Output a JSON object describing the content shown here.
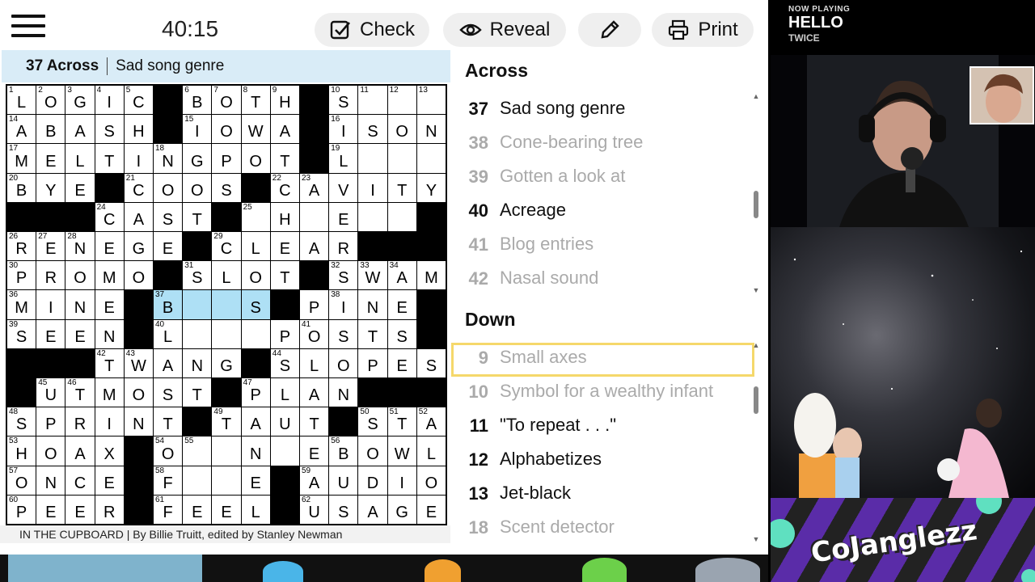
{
  "toolbar": {
    "timer": "40:15",
    "check_label": "Check",
    "reveal_label": "Reveal",
    "print_label": "Print"
  },
  "current_clue": {
    "ref": "37 Across",
    "text": "Sad song genre"
  },
  "grid": {
    "rows": [
      "LOGIC#BOTH#S???",
      "ABASH#IOWA#ISON",
      "MELTINGPOT#L???",
      "BYE#COOS#CAVITY",
      "###CAST#?H?E??#",
      "RENEGE#CLEAR###",
      "PROMO#SLOT#SWAM",
      "MINE#B??S#PINE",
      "SEEN#L???POSTS",
      "###TWANG#SLOPES",
      "#UTMOST#PLAN###",
      "SPRINT#TAUT#STA",
      "HOAX#O??N?EBOWL",
      "ONCE#F??E#AUDIO",
      "PEER#FEEL#USAGE"
    ],
    "numbers": {
      "0,0": "1",
      "0,1": "2",
      "0,2": "3",
      "0,3": "4",
      "0,4": "5",
      "0,6": "6",
      "0,7": "7",
      "0,8": "8",
      "0,9": "9",
      "0,11": "10",
      "0,12": "11",
      "0,13": "12",
      "0,14": "13",
      "1,0": "14",
      "1,6": "15",
      "1,11": "16",
      "2,0": "17",
      "2,5": "18",
      "2,11": "19",
      "3,0": "20",
      "3,4": "21",
      "3,9": "22",
      "3,10": "23",
      "4,3": "24",
      "4,8": "25",
      "5,0": "26",
      "5,1": "27",
      "5,2": "28",
      "5,7": "29",
      "6,0": "30",
      "6,6": "31",
      "6,11": "32",
      "6,12": "33",
      "6,13": "34",
      "7,0": "36",
      "7,5": "37",
      "7,11": "38",
      "8,0": "39",
      "8,5": "40",
      "8,10": "41",
      "9,3": "42",
      "9,4": "43",
      "9,9": "44",
      "10,1": "45",
      "10,2": "46",
      "10,8": "47",
      "11,0": "48",
      "11,7": "49",
      "11,12": "50",
      "11,13": "51",
      "11,14": "52",
      "12,0": "53",
      "12,5": "54",
      "12,6": "55",
      "12,11": "56",
      "13,0": "57",
      "13,5": "58",
      "13,10": "59",
      "14,0": "60",
      "14,5": "61",
      "14,10": "62"
    }
  },
  "byline": "IN THE CUPBOARD | By Billie Truitt, edited by Stanley Newman",
  "across": {
    "title": "Across",
    "clues": [
      {
        "num": "37",
        "text": "Sad song genre",
        "state": "selected"
      },
      {
        "num": "38",
        "text": "Cone-bearing tree",
        "state": "done"
      },
      {
        "num": "39",
        "text": "Gotten a look at",
        "state": "done"
      },
      {
        "num": "40",
        "text": "Acreage",
        "state": ""
      },
      {
        "num": "41",
        "text": "Blog entries",
        "state": "done"
      },
      {
        "num": "42",
        "text": "Nasal sound",
        "state": "done"
      }
    ]
  },
  "down": {
    "title": "Down",
    "clues": [
      {
        "num": "9",
        "text": "Small axes",
        "state": "done cross"
      },
      {
        "num": "10",
        "text": "Symbol for a wealthy infant",
        "state": "done"
      },
      {
        "num": "11",
        "text": "\"To repeat . . .\"",
        "state": ""
      },
      {
        "num": "12",
        "text": "Alphabetizes",
        "state": ""
      },
      {
        "num": "13",
        "text": "Jet-black",
        "state": ""
      },
      {
        "num": "18",
        "text": "Scent detector",
        "state": "done"
      }
    ]
  },
  "stream": {
    "now_playing_label": "NOW PLAYING",
    "song": "HELLO",
    "artist": "TWICE",
    "channel": "CoJanglezz"
  },
  "colors": {
    "selected_clue": "#f5d86b",
    "word_highlight": "#aee0f5",
    "cursor_cell": "#f5d140",
    "clue_bar": "#d9ecf7"
  }
}
